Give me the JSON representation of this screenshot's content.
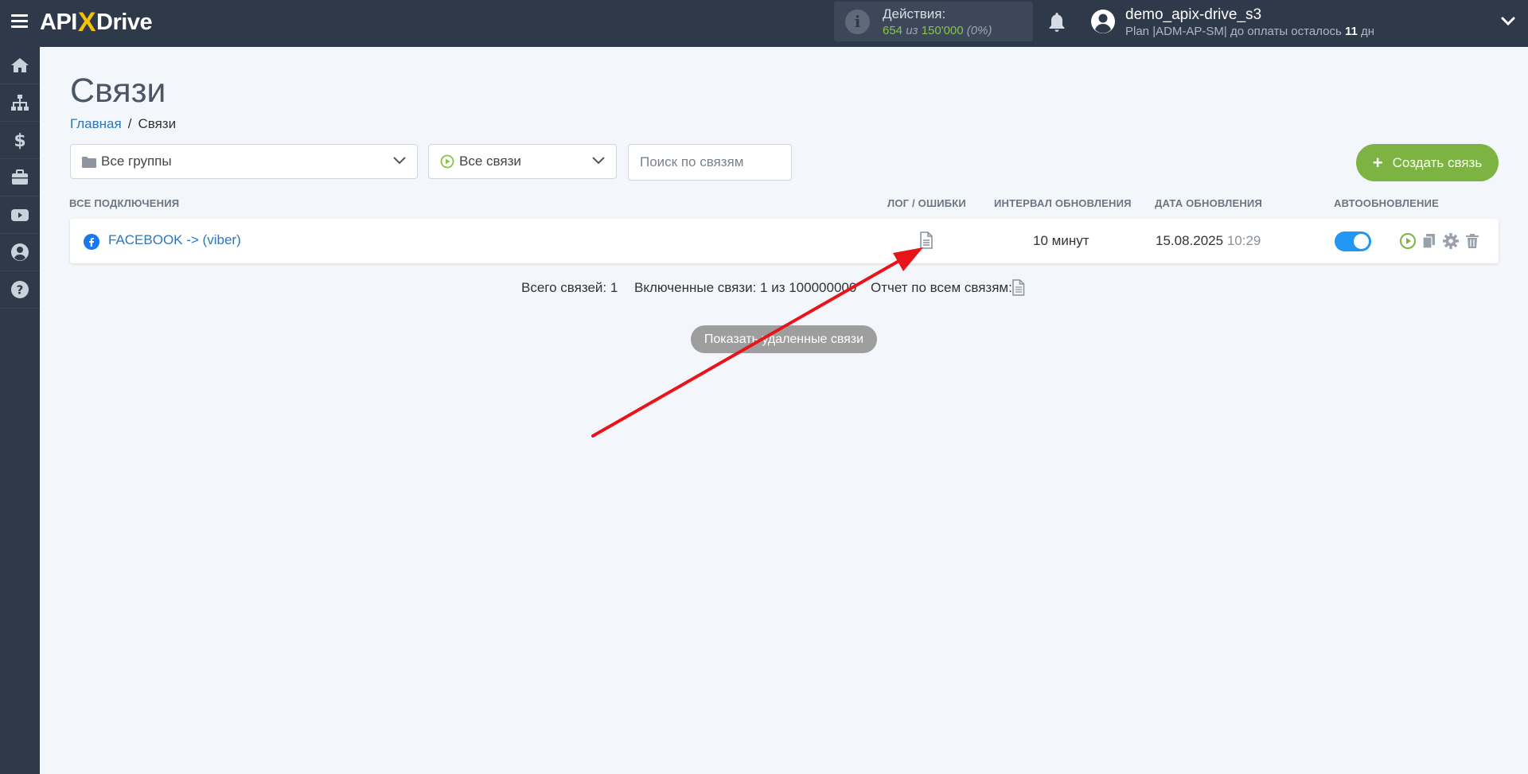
{
  "header": {
    "logo_api": "API",
    "logo_x": "X",
    "logo_drive": "Drive",
    "actions_title": "Действия:",
    "actions_used": "654",
    "actions_of": "из",
    "actions_total": "150'000",
    "actions_percent": "(0%)",
    "user_name": "demo_apix-drive_s3",
    "plan_text": "Plan |ADM-AP-SM| до оплаты осталось",
    "plan_days": "11",
    "plan_days_unit": "дн"
  },
  "sidebar": {
    "items": [
      "home-icon",
      "sitemap-icon",
      "dollar-icon",
      "briefcase-icon",
      "youtube-icon",
      "user-icon",
      "help-icon"
    ]
  },
  "page": {
    "title": "Связи",
    "breadcrumb_home": "Главная",
    "breadcrumb_sep": "/",
    "breadcrumb_current": "Связи"
  },
  "filters": {
    "groups_value": "Все группы",
    "links_value": "Все связи",
    "search_placeholder": "Поиск по связям",
    "create_label": "Создать связь",
    "create_plus": "+"
  },
  "table": {
    "headers": {
      "connections": "ВСЕ ПОДКЛЮЧЕНИЯ",
      "log": "ЛОГ / ОШИБКИ",
      "interval": "ИНТЕРВАЛ ОБНОВЛЕНИЯ",
      "date": "ДАТА ОБНОВЛЕНИЯ",
      "auto": "АВТООБНОВЛЕНИЕ"
    },
    "rows": [
      {
        "name": "FACEBOOK -> (viber)",
        "interval": "10 минут",
        "date": "15.08.2025",
        "time": "10:29",
        "auto_update": true
      }
    ]
  },
  "summary": {
    "total": "Всего связей: 1",
    "enabled": "Включенные связи: 1 из 100000000",
    "report": "Отчет по всем связям:"
  },
  "show_deleted_label": "Показать удаленные связи",
  "colors": {
    "topbar": "#2e3a4a",
    "accent_green": "#7cb342",
    "link_blue": "#2e76b9",
    "toggle_blue": "#2196f3",
    "arrow_red": "#e8141a"
  }
}
